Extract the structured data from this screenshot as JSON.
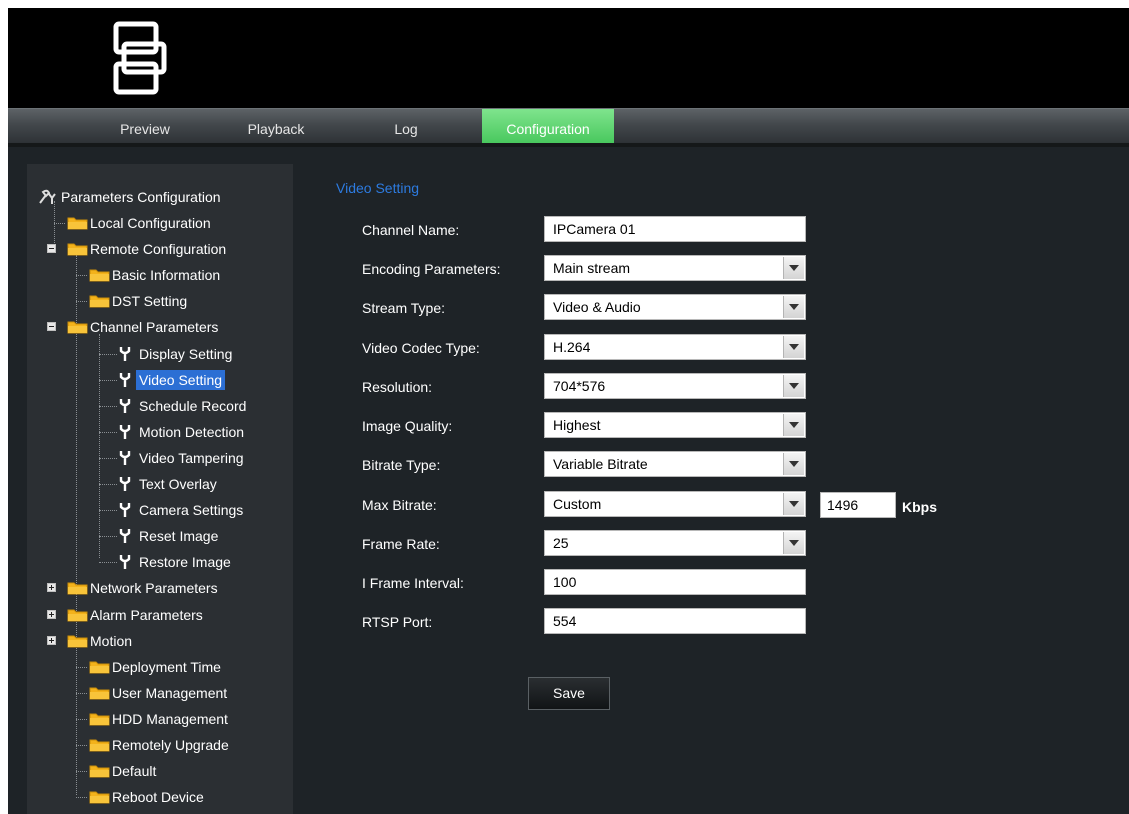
{
  "nav": {
    "tabs": [
      {
        "label": "Preview",
        "active": false
      },
      {
        "label": "Playback",
        "active": false
      },
      {
        "label": "Log",
        "active": false
      },
      {
        "label": "Configuration",
        "active": true
      }
    ]
  },
  "sidebar": {
    "root": "Parameters Configuration",
    "items": [
      {
        "label": "Local Configuration",
        "icon": "folder-icon"
      },
      {
        "label": "Remote Configuration",
        "icon": "folder-icon",
        "expander": "collapse"
      },
      {
        "label": "Basic Information",
        "icon": "folder-icon"
      },
      {
        "label": "DST Setting",
        "icon": "folder-icon"
      },
      {
        "label": "Channel Parameters",
        "icon": "folder-icon",
        "expander": "collapse"
      },
      {
        "label": "Display Setting",
        "icon": "wrench-icon"
      },
      {
        "label": "Video Setting",
        "icon": "wrench-icon",
        "selected": true
      },
      {
        "label": "Schedule Record",
        "icon": "wrench-icon"
      },
      {
        "label": "Motion Detection",
        "icon": "wrench-icon"
      },
      {
        "label": "Video Tampering",
        "icon": "wrench-icon"
      },
      {
        "label": "Text Overlay",
        "icon": "wrench-icon"
      },
      {
        "label": "Camera Settings",
        "icon": "wrench-icon"
      },
      {
        "label": "Reset Image",
        "icon": "wrench-icon"
      },
      {
        "label": "Restore Image",
        "icon": "wrench-icon"
      },
      {
        "label": "Network Parameters",
        "icon": "folder-icon",
        "expander": "expand"
      },
      {
        "label": "Alarm Parameters",
        "icon": "folder-icon",
        "expander": "expand"
      },
      {
        "label": "Motion",
        "icon": "folder-icon",
        "expander": "expand"
      },
      {
        "label": "Deployment Time",
        "icon": "folder-icon"
      },
      {
        "label": "User Management",
        "icon": "folder-icon"
      },
      {
        "label": "HDD Management",
        "icon": "folder-icon"
      },
      {
        "label": "Remotely Upgrade",
        "icon": "folder-icon"
      },
      {
        "label": "Default",
        "icon": "folder-icon"
      },
      {
        "label": "Reboot Device",
        "icon": "folder-icon"
      }
    ]
  },
  "form": {
    "title": "Video Setting",
    "fields": [
      {
        "label": "Channel Name:",
        "value": "IPCamera 01",
        "type": "text"
      },
      {
        "label": "Encoding Parameters:",
        "value": "Main stream",
        "type": "select"
      },
      {
        "label": "Stream Type:",
        "value": "Video & Audio",
        "type": "select"
      },
      {
        "label": "Video Codec Type:",
        "value": "H.264",
        "type": "select"
      },
      {
        "label": "Resolution:",
        "value": "704*576",
        "type": "select"
      },
      {
        "label": "Image Quality:",
        "value": "Highest",
        "type": "select"
      },
      {
        "label": "Bitrate Type:",
        "value": "Variable Bitrate",
        "type": "select"
      },
      {
        "label": "Max Bitrate:",
        "value": "Custom",
        "type": "select"
      },
      {
        "label": "Frame Rate:",
        "value": "25",
        "type": "select"
      },
      {
        "label": "I Frame Interval:",
        "value": "100",
        "type": "text"
      },
      {
        "label": "RTSP Port:",
        "value": "554",
        "type": "text"
      }
    ],
    "custom_bitrate": "1496",
    "bitrate_unit": "Kbps",
    "save_label": "Save"
  },
  "colors": {
    "accent": "#49c85e",
    "selection": "#2c6fd4",
    "title": "#2d7be0"
  }
}
